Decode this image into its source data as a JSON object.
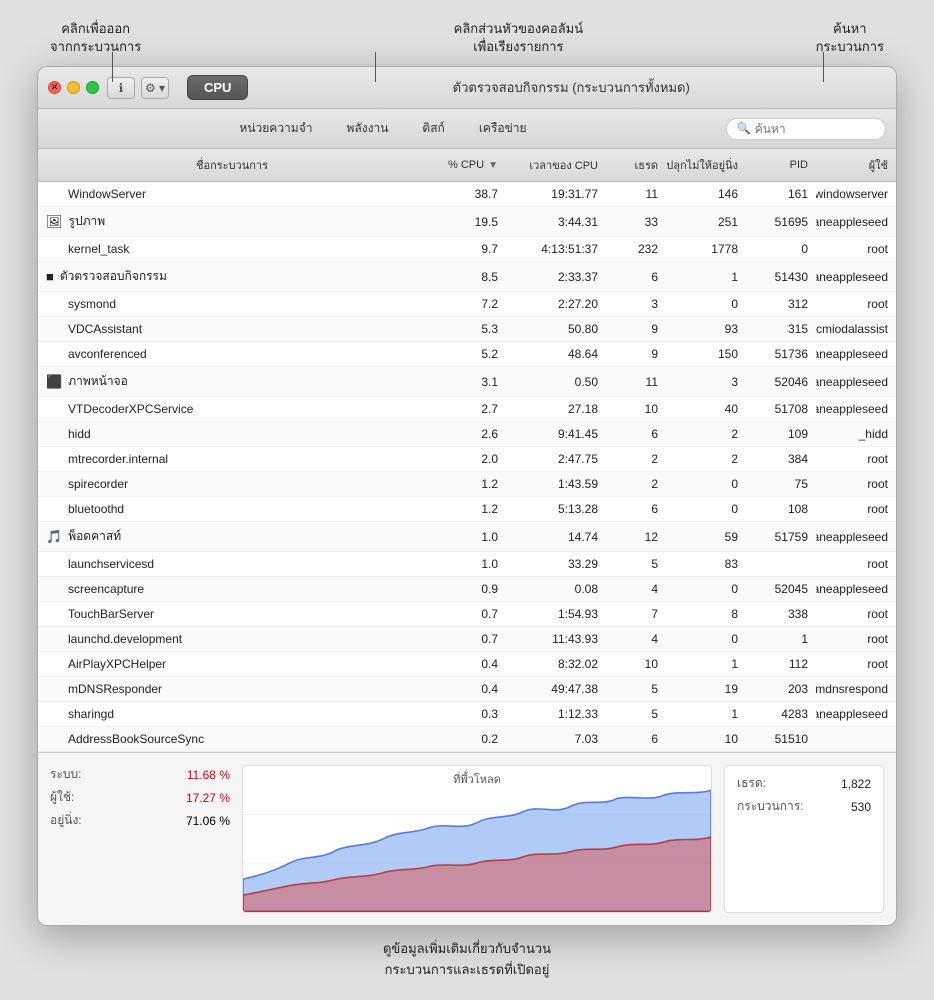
{
  "annotations": {
    "top_left": "คลิกเพื่อออก\nจากกระบวนการ",
    "top_center": "คลิกส่วนหัวของคอลัมน์\nเพื่อเรียงรายการ",
    "top_right": "ค้นหา\nกระบวนการ",
    "bottom": "ดูข้อมูลเพิ่มเติมเกี่ยวกับจำนวน\nกระบวนการและเธรดที่เปิดอยู่"
  },
  "window": {
    "title": "ตัวตรวจสอบกิจกรรม (กระบวนการทั้งหมด)"
  },
  "toolbar": {
    "close_label": "✕",
    "info_label": "ℹ",
    "gear_label": "⚙",
    "cpu_label": "CPU",
    "tabs": [
      "หน่วยความจำ",
      "พลังงาน",
      "ดิสก์",
      "เครือข่าย"
    ],
    "search_placeholder": "ค้นหา"
  },
  "table": {
    "headers": [
      "ชื่อกระบวนการ",
      "% CPU",
      "เวลาของ CPU",
      "เธรด",
      "ปลุกไม่ให้อยู่นิ่ง",
      "PID",
      "ผู้ใช้"
    ],
    "sort_col": "% CPU",
    "rows": [
      {
        "name": "WindowServer",
        "icon": "",
        "cpu": "38.7",
        "time": "19:31.77",
        "threads": "11",
        "wakeups": "146",
        "pid": "161",
        "user": "_windowserver"
      },
      {
        "name": "รูปภาพ",
        "icon": "🖼",
        "cpu": "19.5",
        "time": "3:44.31",
        "threads": "33",
        "wakeups": "251",
        "pid": "51695",
        "user": "janeappleseed"
      },
      {
        "name": "kernel_task",
        "icon": "",
        "cpu": "9.7",
        "time": "4:13:51:37",
        "threads": "232",
        "wakeups": "1778",
        "pid": "0",
        "user": "root"
      },
      {
        "name": "ตัวตรวจสอบกิจกรรม",
        "icon": "■",
        "cpu": "8.5",
        "time": "2:33.37",
        "threads": "6",
        "wakeups": "1",
        "pid": "51430",
        "user": "janeappleseed"
      },
      {
        "name": "sysmond",
        "icon": "",
        "cpu": "7.2",
        "time": "2:27.20",
        "threads": "3",
        "wakeups": "0",
        "pid": "312",
        "user": "root"
      },
      {
        "name": "VDCAssistant",
        "icon": "",
        "cpu": "5.3",
        "time": "50.80",
        "threads": "9",
        "wakeups": "93",
        "pid": "315",
        "user": "_cmiodalassist"
      },
      {
        "name": "avconferenced",
        "icon": "",
        "cpu": "5.2",
        "time": "48.64",
        "threads": "9",
        "wakeups": "150",
        "pid": "51736",
        "user": "janeappleseed"
      },
      {
        "name": "ภาพหน้าจอ",
        "icon": "⬛",
        "cpu": "3.1",
        "time": "0.50",
        "threads": "11",
        "wakeups": "3",
        "pid": "52046",
        "user": "janeappleseed"
      },
      {
        "name": "VTDecoderXPCService",
        "icon": "",
        "cpu": "2.7",
        "time": "27.18",
        "threads": "10",
        "wakeups": "40",
        "pid": "51708",
        "user": "janeappleseed"
      },
      {
        "name": "hidd",
        "icon": "",
        "cpu": "2.6",
        "time": "9:41.45",
        "threads": "6",
        "wakeups": "2",
        "pid": "109",
        "user": "_hidd"
      },
      {
        "name": "mtrecorder.internal",
        "icon": "",
        "cpu": "2.0",
        "time": "2:47.75",
        "threads": "2",
        "wakeups": "2",
        "pid": "384",
        "user": "root"
      },
      {
        "name": "spirecorder",
        "icon": "",
        "cpu": "1.2",
        "time": "1:43.59",
        "threads": "2",
        "wakeups": "0",
        "pid": "75",
        "user": "root"
      },
      {
        "name": "bluetoothd",
        "icon": "",
        "cpu": "1.2",
        "time": "5:13.28",
        "threads": "6",
        "wakeups": "0",
        "pid": "108",
        "user": "root"
      },
      {
        "name": "พ็อดคาสท์",
        "icon": "🎵",
        "cpu": "1.0",
        "time": "14.74",
        "threads": "12",
        "wakeups": "59",
        "pid": "51759",
        "user": "janeappleseed"
      },
      {
        "name": "launchservicesd",
        "icon": "",
        "cpu": "1.0",
        "time": "33.29",
        "threads": "5",
        "wakeups": "83",
        "pid": "",
        "user": "root"
      },
      {
        "name": "screencapture",
        "icon": "",
        "cpu": "0.9",
        "time": "0.08",
        "threads": "4",
        "wakeups": "0",
        "pid": "52045",
        "user": "janeappleseed"
      },
      {
        "name": "TouchBarServer",
        "icon": "",
        "cpu": "0.7",
        "time": "1:54.93",
        "threads": "7",
        "wakeups": "8",
        "pid": "338",
        "user": "root"
      },
      {
        "name": "launchd.development",
        "icon": "",
        "cpu": "0.7",
        "time": "11:43.93",
        "threads": "4",
        "wakeups": "0",
        "pid": "1",
        "user": "root"
      },
      {
        "name": "AirPlayXPCHelper",
        "icon": "",
        "cpu": "0.4",
        "time": "8:32.02",
        "threads": "10",
        "wakeups": "1",
        "pid": "112",
        "user": "root"
      },
      {
        "name": "mDNSResponder",
        "icon": "",
        "cpu": "0.4",
        "time": "49:47.38",
        "threads": "5",
        "wakeups": "19",
        "pid": "203",
        "user": "_mdnsrespond"
      },
      {
        "name": "sharingd",
        "icon": "",
        "cpu": "0.3",
        "time": "1:12.33",
        "threads": "5",
        "wakeups": "1",
        "pid": "4283",
        "user": "janeappleseed"
      },
      {
        "name": "AddressBookSourceSync",
        "icon": "",
        "cpu": "0.2",
        "time": "7.03",
        "threads": "6",
        "wakeups": "10",
        "pid": "51510",
        "user": ""
      }
    ]
  },
  "bottom": {
    "stats": {
      "system_label": "ระบบ:",
      "system_value": "11.68 %",
      "user_label": "ผู้ใช้:",
      "user_value": "17.27 %",
      "idle_label": "อยู่นิ่ง:",
      "idle_value": "71.06 %"
    },
    "chart_label": "ที่พี้่วโหลด",
    "right_stats": {
      "threads_label": "เธรด:",
      "threads_value": "1,822",
      "processes_label": "กระบวนการ:",
      "processes_value": "530"
    }
  }
}
